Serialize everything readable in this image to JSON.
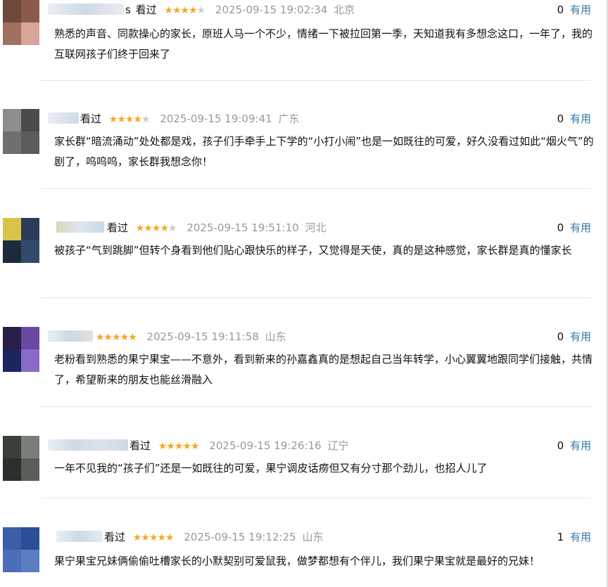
{
  "reviews": [
    {
      "name_tail": "s",
      "seen": "看过",
      "stars": 4,
      "time": "2025-09-15 19:02:34",
      "location": "北京",
      "useful_count": "0",
      "useful_label": "有用",
      "content": "熟悉的声音、同款操心的家长，原班人马一个不少，情绪一下被拉回第一季，天知道我有多想念这口，一年了，我的互联网孩子们终于回来了"
    },
    {
      "name_tail": "",
      "seen": "看过",
      "stars": 4,
      "time": "2025-09-15 19:09:41",
      "location": "广东",
      "useful_count": "0",
      "useful_label": "有用",
      "content": "家长群“暗流涌动”处处都是戏，孩子们手牵手上下学的“小打小闹”也是一如既往的可爱，好久没看过如此“烟火气”的剧了，呜呜呜，家长群我想念你！"
    },
    {
      "name_tail": "",
      "seen": "看过",
      "stars": 4,
      "time": "2025-09-15 19:51:10",
      "location": "河北",
      "useful_count": "0",
      "useful_label": "有用",
      "content": "被孩子“气到跳脚”但转个身看到他们贴心跟快乐的样子，又觉得是天使，真的是这种感觉，家长群是真的懂家长"
    },
    {
      "name_tail": "",
      "seen": "",
      "stars": 5,
      "time": "2025-09-15 19:11:58",
      "location": "山东",
      "useful_count": "0",
      "useful_label": "有用",
      "content": "老粉看到熟悉的果宁果宝——不意外，看到新来的孙嘉鑫真的是想起自己当年转学，小心翼翼地跟同学们接触，共情了，希望新来的朋友也能丝滑融入"
    },
    {
      "name_tail": "",
      "seen": "看过",
      "stars": 5,
      "time": "2025-09-15 19:26:16",
      "location": "辽宁",
      "useful_count": "0",
      "useful_label": "有用",
      "content": "一年不见我的“孩子们”还是一如既往的可爱，果宁调皮话痨但又有分寸那个劲儿，也招人儿了"
    },
    {
      "name_tail": "",
      "seen": "看过",
      "stars": 5,
      "time": "2025-09-15 19:12:25",
      "location": "山东",
      "useful_count": "1",
      "useful_label": "有用",
      "content": "果宁果宝兄妹俩偷偷吐槽家长的小默契别可爱鼠我，做梦都想有个伴儿，我们果宁果宝就是最好的兄妹！"
    }
  ],
  "icons": {
    "star": "★"
  },
  "colors": {
    "star": "#f5a623",
    "star_off": "#cccccc",
    "link": "#3377aa",
    "meta": "#999999"
  }
}
